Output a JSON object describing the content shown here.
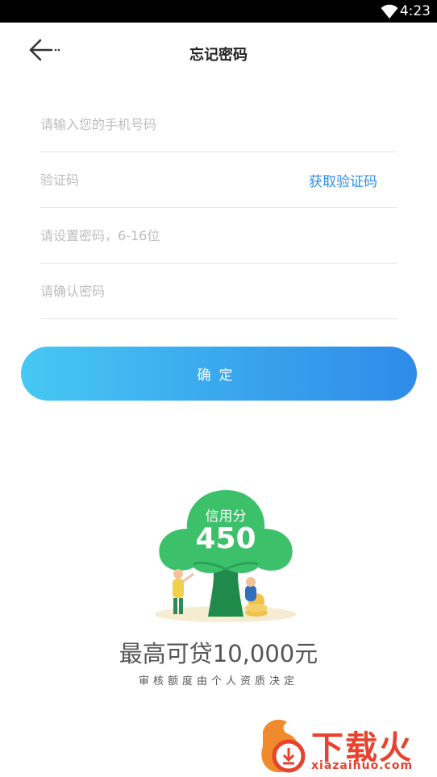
{
  "status_bar": {
    "time": "4:23"
  },
  "header": {
    "title": "忘记密码"
  },
  "form": {
    "phone_placeholder": "请输入您的手机号码",
    "code_placeholder": "验证码",
    "get_code_label": "获取验证码",
    "password_placeholder": "请设置密码，6-16位",
    "confirm_password_placeholder": "请确认密码",
    "submit_label": "确定"
  },
  "promo": {
    "credit_label": "信用分",
    "credit_score": "450",
    "headline": "最高可贷10,000元",
    "subtitle": "审核额度由个人资质决定"
  },
  "watermark": {
    "title": "下载火",
    "url": "xiazaihuo.com"
  },
  "colors": {
    "accent": "#2f8fe8",
    "button_start": "#47c8f3",
    "button_end": "#2f8be8",
    "tree": "#3cc06a",
    "watermark": "#e8422d"
  }
}
